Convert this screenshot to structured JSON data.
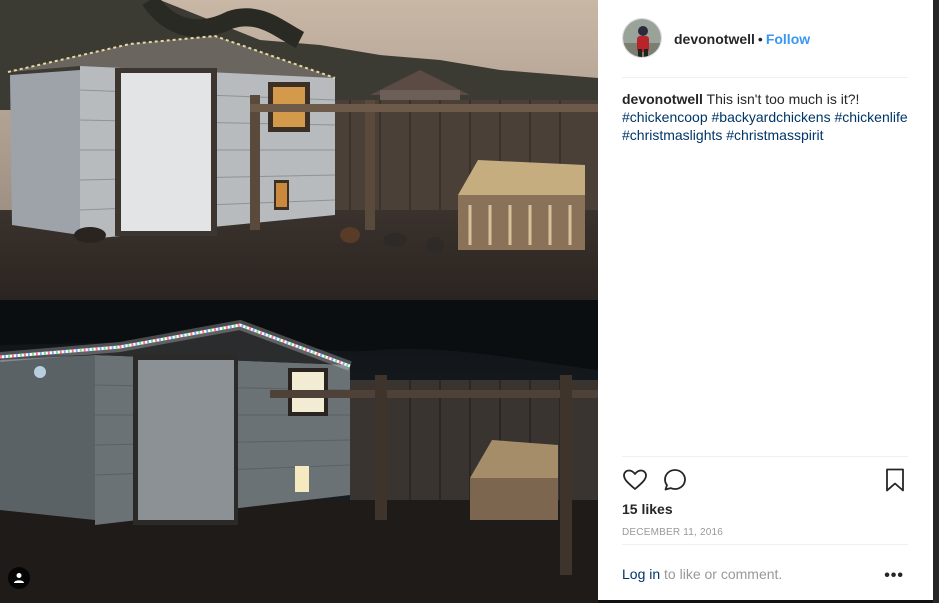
{
  "post": {
    "username": "devonotwell",
    "separator": "•",
    "follow_label": "Follow",
    "caption_user": "devonotwell",
    "caption_text": "This isn't too much is it?!",
    "hashtags": [
      "#chickencoop",
      "#backyardchickens",
      "#chickenlife",
      "#christmaslights",
      "#christmasspirit"
    ],
    "likes": "15 likes",
    "date": "December 11, 2016",
    "login_label": "Log in",
    "comment_suffix": " to like or comment.",
    "more_label": "•••"
  },
  "icons": {
    "like": "heart-icon",
    "comment": "comment-bubble-icon",
    "save": "bookmark-icon",
    "user_tag": "user-tag-icon"
  },
  "colors": {
    "link_blue": "#3897f0",
    "hashtag": "#003569",
    "text": "#262626",
    "muted": "#999999"
  }
}
